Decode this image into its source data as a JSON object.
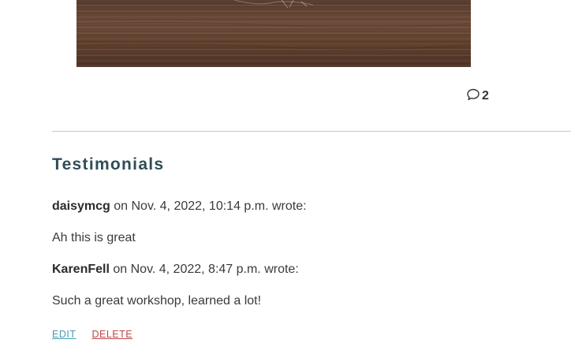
{
  "post": {
    "comment_count": "2"
  },
  "testimonials": {
    "title": "Testimonials",
    "items": [
      {
        "author": "daisymcg",
        "meta": " on Nov. 4, 2022, 10:14 p.m. wrote:",
        "text": "Ah this is great"
      },
      {
        "author": "KarenFell",
        "meta": " on Nov. 4, 2022, 8:47 p.m. wrote:",
        "text": "Such a great workshop, learned a lot!"
      }
    ],
    "actions": {
      "edit_label": "EDIT",
      "delete_label": "DELETE"
    }
  },
  "colors": {
    "heading": "#2f4d57",
    "edit_link": "#4a9ab0",
    "delete_link": "#c0464a",
    "divider": "#c7c7c7"
  },
  "icons": {
    "comment": "speech-bubble-icon"
  }
}
